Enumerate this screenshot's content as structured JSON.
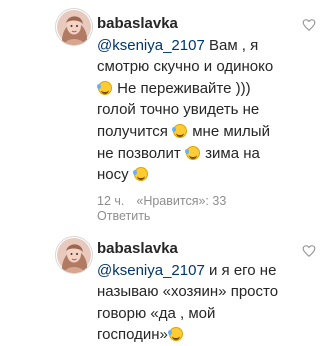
{
  "comments": [
    {
      "username": "babaslavka",
      "mention": "@kseniya_2107",
      "text_parts": [
        " Вам , я смотрю скучно и одиноко ",
        " Не переживайте ))) голой точно увидеть не получится ",
        " мне милый не позволит ",
        " зима на носу "
      ],
      "emoji": "rofl-emoji",
      "time": "12 ч.",
      "likes": "«Нравится»: 33",
      "reply_label": "Ответить"
    },
    {
      "username": "babaslavka",
      "mention": "@kseniya_2107",
      "text_parts": [
        " и я его не называю «хозяин» просто говорю «да , мой господин»"
      ],
      "emoji": "rofl-emoji"
    }
  ],
  "colors": {
    "username": "#262626",
    "mention": "#00376b",
    "meta": "#8e8e8e"
  },
  "icons": [
    "avatar",
    "heart-icon",
    "rofl-emoji"
  ]
}
